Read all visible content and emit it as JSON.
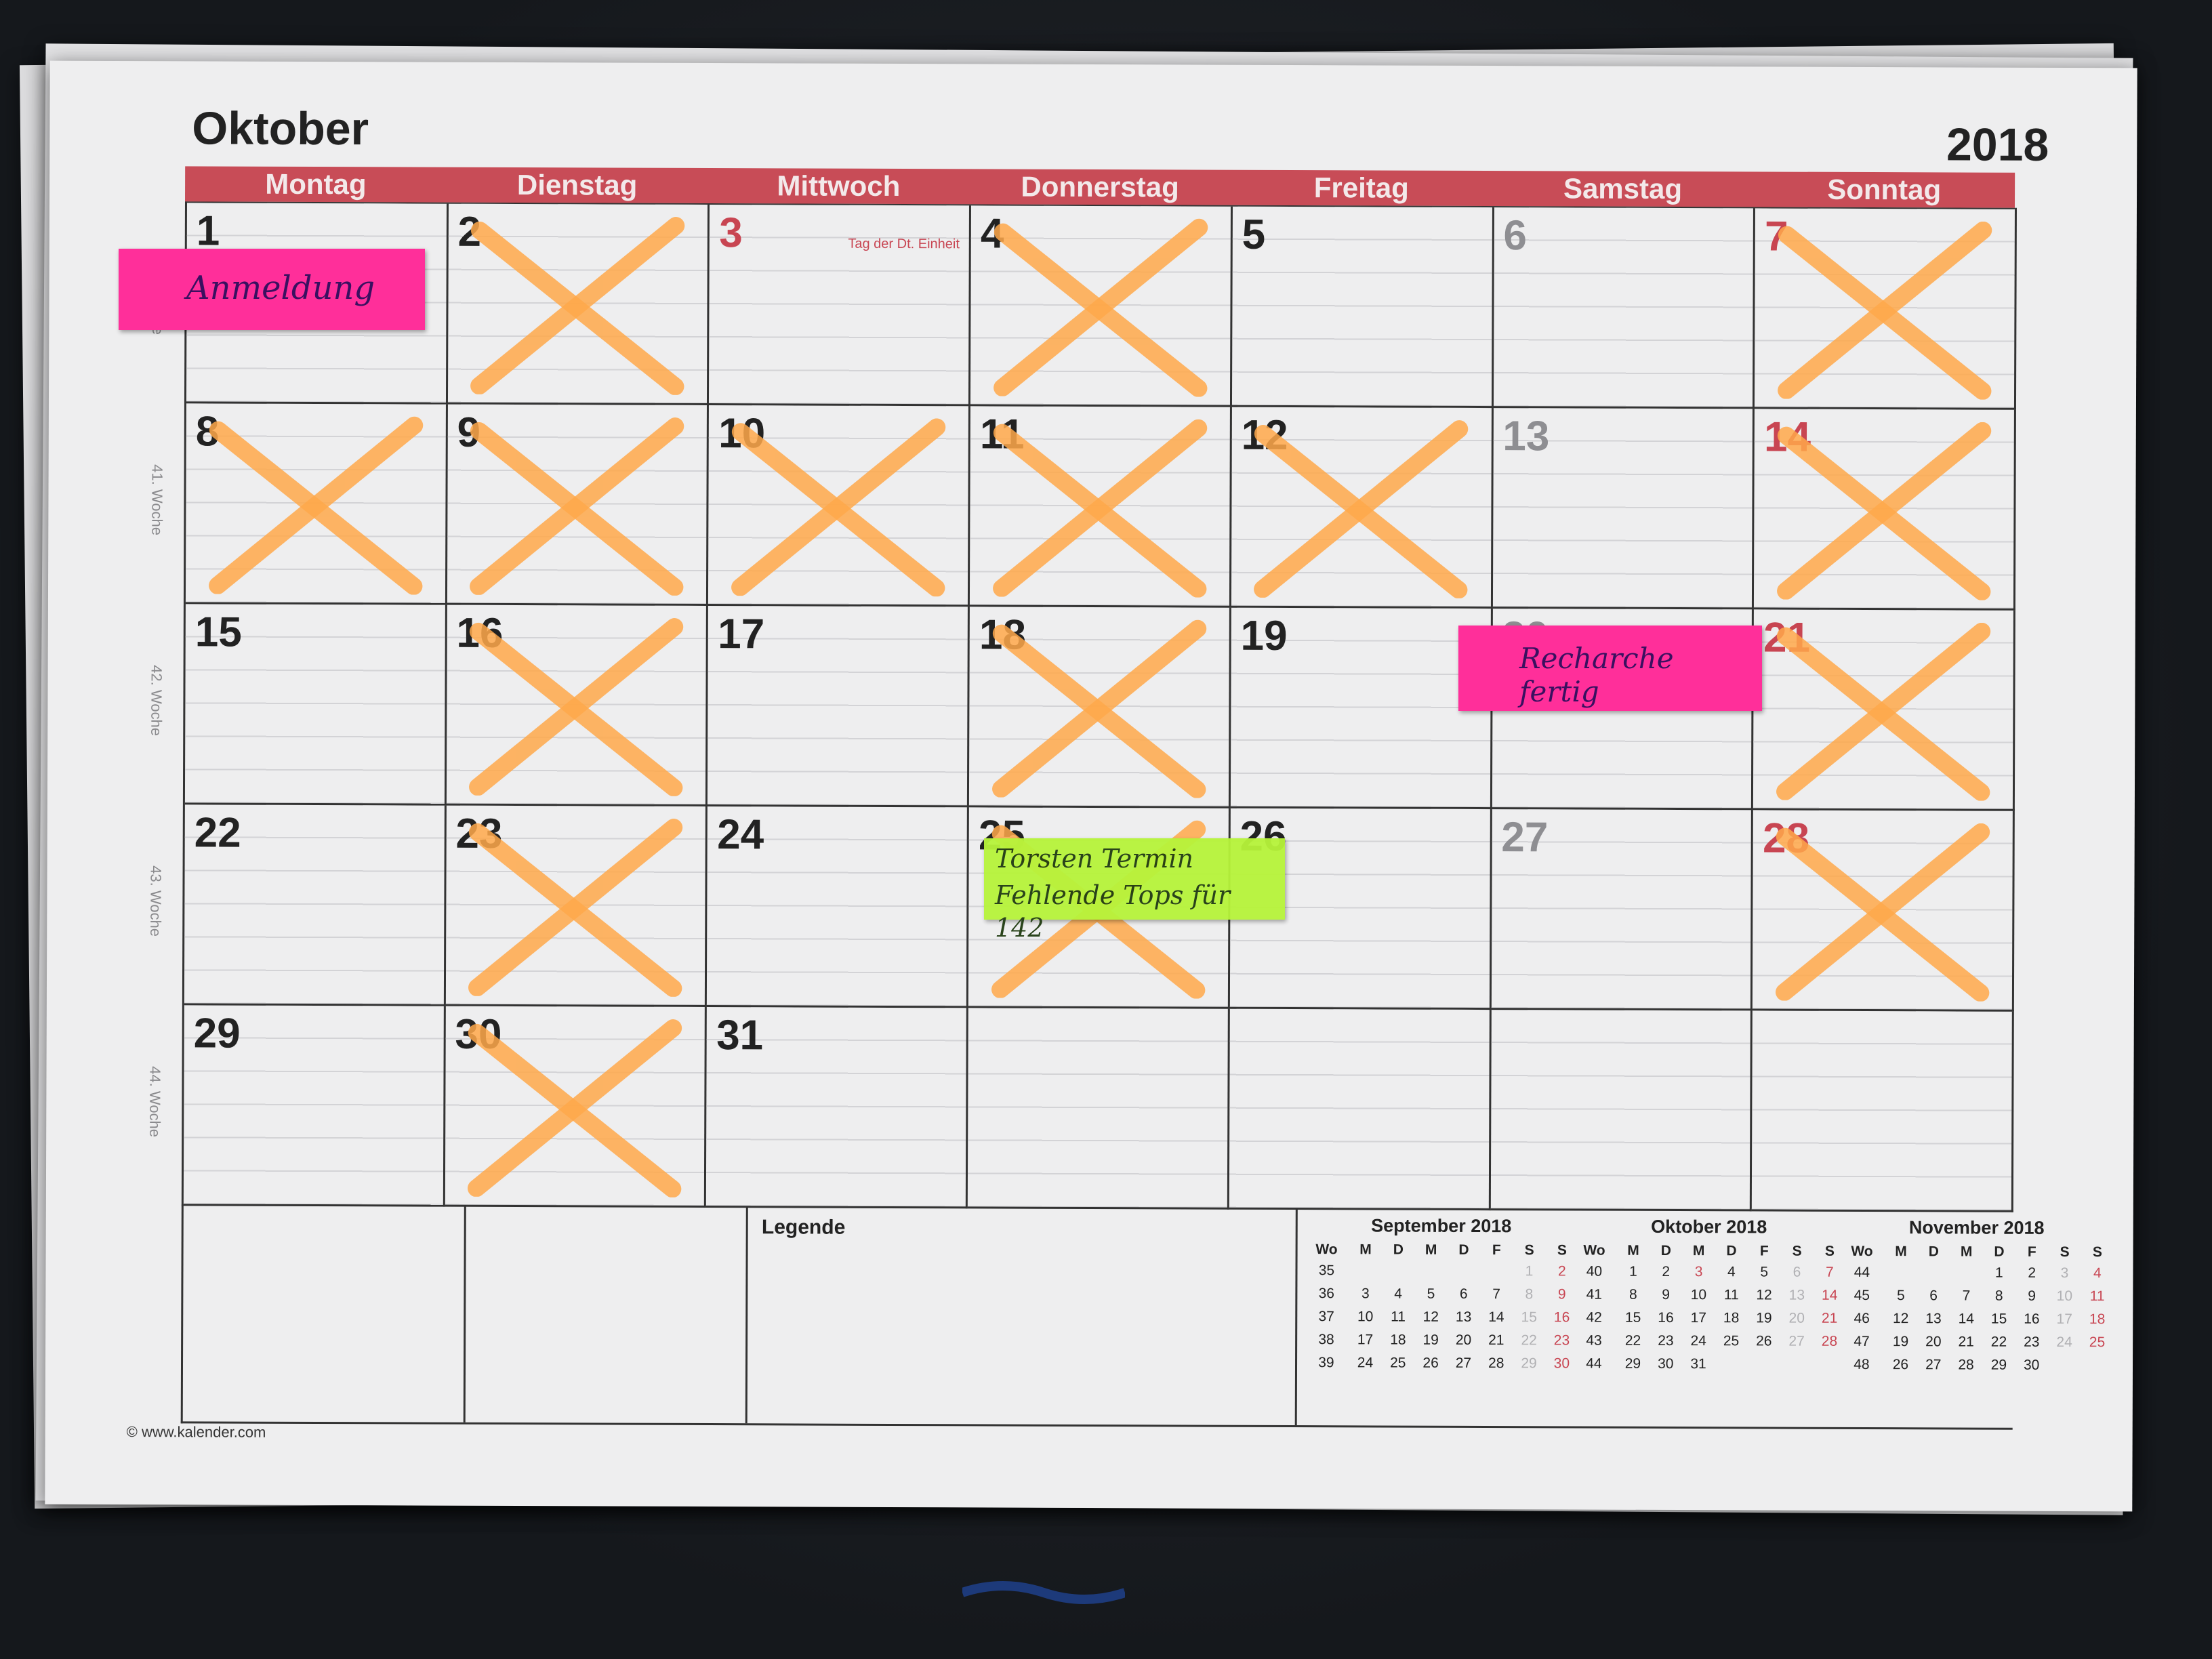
{
  "calendar": {
    "month": "Oktober",
    "year": "2018",
    "weekdays": [
      "Montag",
      "Dienstag",
      "Mittwoch",
      "Donnerstag",
      "Freitag",
      "Samstag",
      "Sonntag"
    ],
    "days": [
      {
        "num": "1",
        "style": "normal",
        "crossed": false
      },
      {
        "num": "2",
        "style": "normal",
        "crossed": true
      },
      {
        "num": "3",
        "style": "red",
        "crossed": false,
        "note": "Tag der Dt. Einheit"
      },
      {
        "num": "4",
        "style": "normal",
        "crossed": true
      },
      {
        "num": "5",
        "style": "normal",
        "crossed": false
      },
      {
        "num": "6",
        "style": "grey",
        "crossed": false
      },
      {
        "num": "7",
        "style": "red",
        "crossed": true
      },
      {
        "num": "8",
        "style": "normal",
        "crossed": true
      },
      {
        "num": "9",
        "style": "normal",
        "crossed": true
      },
      {
        "num": "10",
        "style": "normal",
        "crossed": true
      },
      {
        "num": "11",
        "style": "normal",
        "crossed": true
      },
      {
        "num": "12",
        "style": "normal",
        "crossed": true
      },
      {
        "num": "13",
        "style": "grey",
        "crossed": false
      },
      {
        "num": "14",
        "style": "red",
        "crossed": true
      },
      {
        "num": "15",
        "style": "normal",
        "crossed": false
      },
      {
        "num": "16",
        "style": "normal",
        "crossed": true
      },
      {
        "num": "17",
        "style": "normal",
        "crossed": false
      },
      {
        "num": "18",
        "style": "normal",
        "crossed": true
      },
      {
        "num": "19",
        "style": "normal",
        "crossed": false
      },
      {
        "num": "20",
        "style": "grey",
        "crossed": false
      },
      {
        "num": "21",
        "style": "red",
        "crossed": true
      },
      {
        "num": "22",
        "style": "normal",
        "crossed": false
      },
      {
        "num": "23",
        "style": "normal",
        "crossed": true
      },
      {
        "num": "24",
        "style": "normal",
        "crossed": false
      },
      {
        "num": "25",
        "style": "normal",
        "crossed": true
      },
      {
        "num": "26",
        "style": "normal",
        "crossed": false
      },
      {
        "num": "27",
        "style": "grey",
        "crossed": false
      },
      {
        "num": "28",
        "style": "red",
        "crossed": true
      },
      {
        "num": "29",
        "style": "normal",
        "crossed": false
      },
      {
        "num": "30",
        "style": "normal",
        "crossed": true
      },
      {
        "num": "31",
        "style": "normal",
        "crossed": false
      },
      {
        "num": "",
        "style": "normal",
        "crossed": false
      },
      {
        "num": "",
        "style": "normal",
        "crossed": false
      },
      {
        "num": "",
        "style": "normal",
        "crossed": false
      },
      {
        "num": "",
        "style": "normal",
        "crossed": false
      }
    ],
    "week_labels": [
      "40. Woche",
      "41. Woche",
      "42. Woche",
      "43. Woche",
      "44. Woche"
    ],
    "legend_label": "Legende",
    "copyright": "© www.kalender.com"
  },
  "mini_calendars": [
    {
      "title": "September 2018",
      "headers": [
        "Wo",
        "M",
        "D",
        "M",
        "D",
        "F",
        "S",
        "S"
      ],
      "rows": [
        [
          "35",
          "",
          "",
          "",
          "",
          "",
          "1",
          "2"
        ],
        [
          "36",
          "3",
          "4",
          "5",
          "6",
          "7",
          "8",
          "9"
        ],
        [
          "37",
          "10",
          "11",
          "12",
          "13",
          "14",
          "15",
          "16"
        ],
        [
          "38",
          "17",
          "18",
          "19",
          "20",
          "21",
          "22",
          "23"
        ],
        [
          "39",
          "24",
          "25",
          "26",
          "27",
          "28",
          "29",
          "30"
        ]
      ]
    },
    {
      "title": "Oktober 2018",
      "headers": [
        "Wo",
        "M",
        "D",
        "M",
        "D",
        "F",
        "S",
        "S"
      ],
      "rows": [
        [
          "40",
          "1",
          "2",
          "3",
          "4",
          "5",
          "6",
          "7"
        ],
        [
          "41",
          "8",
          "9",
          "10",
          "11",
          "12",
          "13",
          "14"
        ],
        [
          "42",
          "15",
          "16",
          "17",
          "18",
          "19",
          "20",
          "21"
        ],
        [
          "43",
          "22",
          "23",
          "24",
          "25",
          "26",
          "27",
          "28"
        ],
        [
          "44",
          "29",
          "30",
          "31",
          "",
          "",
          "",
          ""
        ]
      ],
      "holiday": "3"
    },
    {
      "title": "November 2018",
      "headers": [
        "Wo",
        "M",
        "D",
        "M",
        "D",
        "F",
        "S",
        "S"
      ],
      "rows": [
        [
          "44",
          "",
          "",
          "",
          "1",
          "2",
          "3",
          "4"
        ],
        [
          "45",
          "5",
          "6",
          "7",
          "8",
          "9",
          "10",
          "11"
        ],
        [
          "46",
          "12",
          "13",
          "14",
          "15",
          "16",
          "17",
          "18"
        ],
        [
          "47",
          "19",
          "20",
          "21",
          "22",
          "23",
          "24",
          "25"
        ],
        [
          "48",
          "26",
          "27",
          "28",
          "29",
          "30",
          "",
          ""
        ]
      ]
    }
  ],
  "sticky_notes": {
    "anmeldung": "Anmeldung",
    "recherche": "Recharche fertig",
    "torsten_line1": "Torsten Termin",
    "torsten_line2": "Fehlende Tops für 142"
  },
  "colors": {
    "header_red": "#c84c57",
    "cross_orange": "#ffa94b",
    "sticky_pink": "#ff2f9a",
    "sticky_green": "#b7f43a"
  }
}
